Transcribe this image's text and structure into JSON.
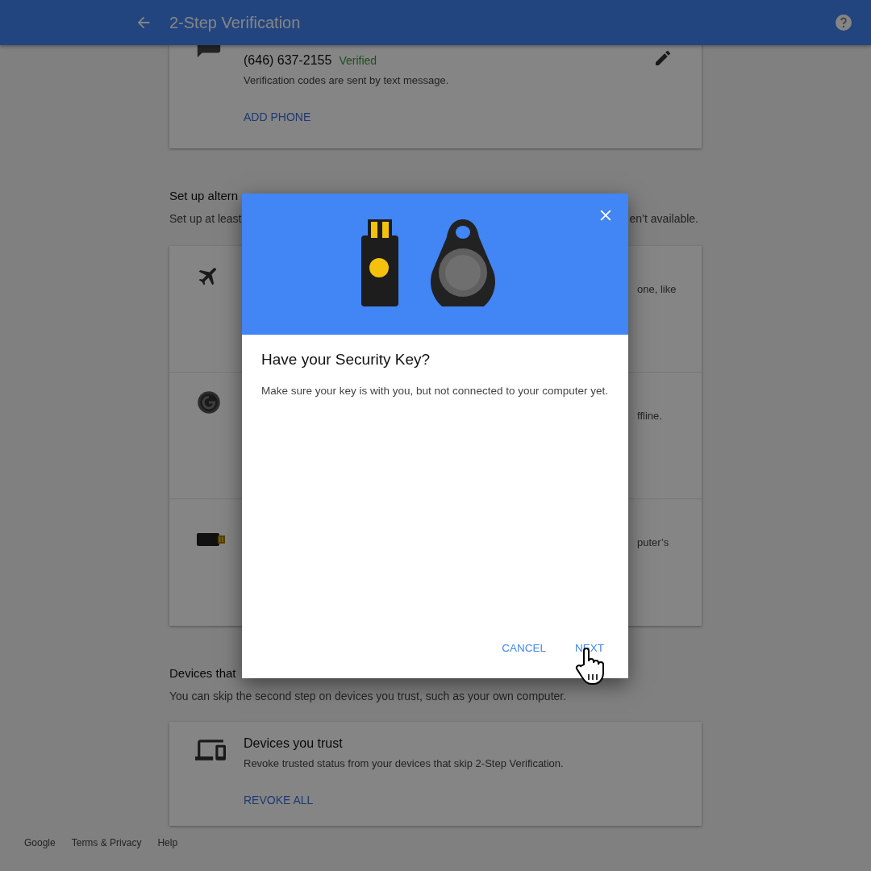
{
  "app_bar": {
    "title": "2-Step Verification"
  },
  "phone_card": {
    "phone": "(646) 637-2155",
    "status": "Verified",
    "description": "Verification codes are sent by text message.",
    "action": "ADD PHONE"
  },
  "alternative_section": {
    "heading": "Set up altern",
    "subtitle_start": "Set up at least",
    "subtitle_end": "en’t available.",
    "options": [
      {
        "kind": "airplane",
        "text": "one, like"
      },
      {
        "kind": "authenticator",
        "text": "ffline."
      },
      {
        "kind": "usb-key",
        "text": "puter’s"
      }
    ]
  },
  "devices_section": {
    "heading": "Devices that",
    "subtitle": "You can skip the second step on devices you trust, such as your own computer.",
    "card": {
      "title": "Devices you trust",
      "description": "Revoke trusted status from your devices that skip 2-Step Verification.",
      "action": "REVOKE ALL"
    }
  },
  "footer": [
    "Google",
    "Terms & Privacy",
    "Help"
  ],
  "dialog": {
    "title": "Have your Security Key?",
    "body": "Make sure your key is with you, but not connected to your computer yet.",
    "buttons": [
      "CANCEL",
      "NEXT"
    ]
  }
}
